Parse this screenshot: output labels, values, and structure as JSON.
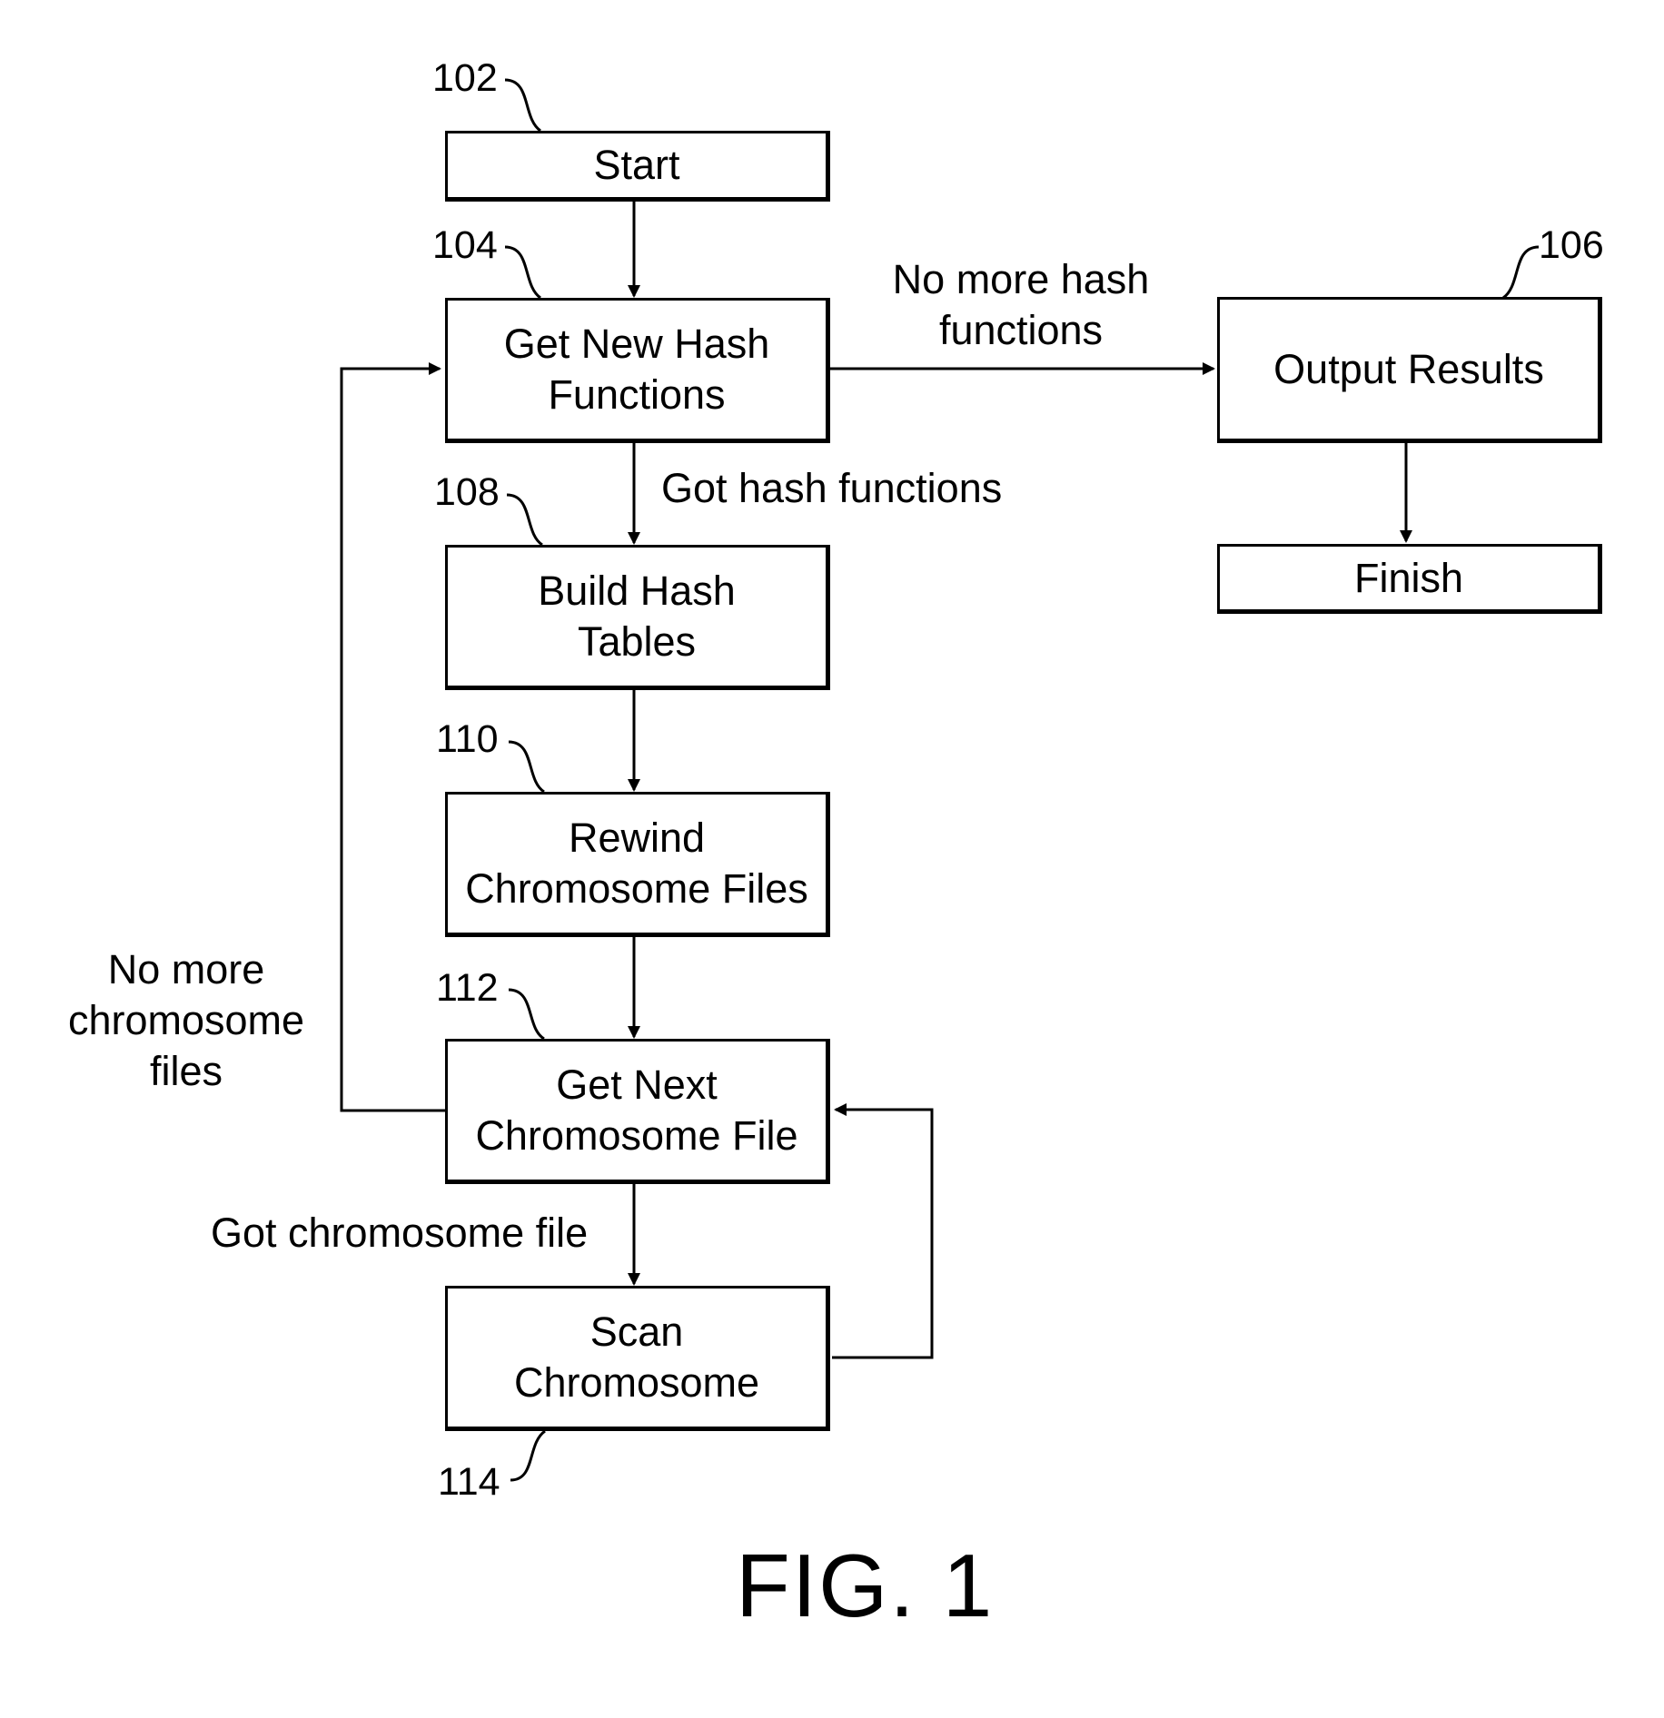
{
  "figure": {
    "caption": "FIG. 1"
  },
  "nodes": {
    "start": {
      "ref": "102",
      "label": "Start"
    },
    "get_hash": {
      "ref": "104",
      "label": "Get New Hash\nFunctions"
    },
    "output": {
      "ref": "106",
      "label": "Output Results"
    },
    "finish": {
      "label": "Finish"
    },
    "build": {
      "ref": "108",
      "label": "Build Hash\nTables"
    },
    "rewind": {
      "ref": "110",
      "label": "Rewind\nChromosome Files"
    },
    "get_next": {
      "ref": "112",
      "label": "Get Next\nChromosome File"
    },
    "scan": {
      "ref": "114",
      "label": "Scan\nChromosome"
    }
  },
  "edges": {
    "no_more_hash": "No more hash\nfunctions",
    "got_hash": "Got hash functions",
    "no_more_chrom": "No more\nchromosome\nfiles",
    "got_chrom": "Got chromosome file"
  }
}
